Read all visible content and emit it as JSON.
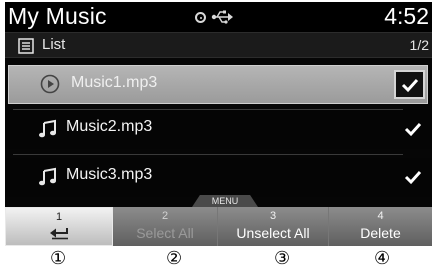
{
  "status_bar": {
    "title": "My Music",
    "time": "4:52",
    "icons": [
      "disc-icon",
      "usb-icon"
    ]
  },
  "list_header": {
    "label": "List",
    "page": "1/2",
    "icon": "list-icon"
  },
  "rows": [
    {
      "name": "Music1.mp3",
      "icon": "play-icon",
      "checked": true,
      "selected": true
    },
    {
      "name": "Music2.mp3",
      "icon": "music-note-icon",
      "checked": true,
      "selected": false
    },
    {
      "name": "Music3.mp3",
      "icon": "music-note-icon",
      "checked": true,
      "selected": false
    }
  ],
  "menu_tab": "MENU",
  "softkeys": [
    {
      "num": "1",
      "label": "",
      "icon": "back-arrow-icon"
    },
    {
      "num": "2",
      "label": "Select All",
      "disabled": true
    },
    {
      "num": "3",
      "label": "Unselect All"
    },
    {
      "num": "4",
      "label": "Delete"
    }
  ],
  "callouts": [
    "①",
    "②",
    "③",
    "④"
  ],
  "colors": {
    "screen_bg": "#060606",
    "selected_row": "#aaaaaa",
    "active_softkey": "#e0e0e0",
    "softkey": "#767676",
    "disabled_text": "#9a9a9a"
  }
}
